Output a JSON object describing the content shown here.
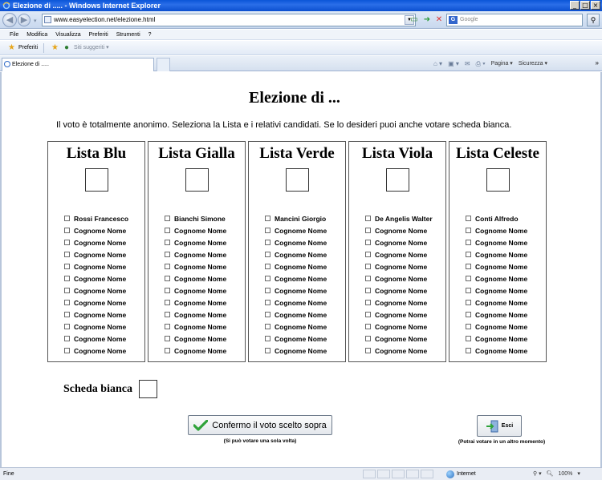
{
  "window": {
    "title": "Elezione di ..... - Windows Internet Explorer",
    "minimize": "_",
    "maximize": "□",
    "close": "×"
  },
  "address": {
    "url": "www.easyelection.net/elezione.html",
    "search_placeholder": "Google"
  },
  "menu": [
    "File",
    "Modifica",
    "Visualizza",
    "Preferiti",
    "Strumenti",
    "?"
  ],
  "favorites": {
    "label": "Preferiti",
    "suggested": "Siti suggeriti ▾"
  },
  "tab": {
    "label": "Elezione di .....",
    "commands": [
      "Pagina ▾",
      "Sicurezza ▾"
    ],
    "more": "»"
  },
  "page": {
    "title": "Elezione di ...",
    "intro": "Il voto è totalmente anonimo. Seleziona la Lista e i relativi candidati. Se lo desideri puoi anche votare scheda bianca.",
    "lists": [
      {
        "name": "Lista Blu",
        "candidates": [
          "Rossi Francesco",
          "Cognome Nome",
          "Cognome Nome",
          "Cognome Nome",
          "Cognome Nome",
          "Cognome Nome",
          "Cognome Nome",
          "Cognome Nome",
          "Cognome Nome",
          "Cognome Nome",
          "Cognome Nome",
          "Cognome Nome"
        ]
      },
      {
        "name": "Lista Gialla",
        "candidates": [
          "Bianchi Simone",
          "Cognome Nome",
          "Cognome Nome",
          "Cognome Nome",
          "Cognome Nome",
          "Cognome Nome",
          "Cognome Nome",
          "Cognome Nome",
          "Cognome Nome",
          "Cognome Nome",
          "Cognome Nome",
          "Cognome Nome"
        ]
      },
      {
        "name": "Lista Verde",
        "candidates": [
          "Mancini Giorgio",
          "Cognome Nome",
          "Cognome Nome",
          "Cognome Nome",
          "Cognome Nome",
          "Cognome Nome",
          "Cognome Nome",
          "Cognome Nome",
          "Cognome Nome",
          "Cognome Nome",
          "Cognome Nome",
          "Cognome Nome"
        ]
      },
      {
        "name": "Lista Viola",
        "candidates": [
          "De Angelis Walter",
          "Cognome Nome",
          "Cognome Nome",
          "Cognome Nome",
          "Cognome Nome",
          "Cognome Nome",
          "Cognome Nome",
          "Cognome Nome",
          "Cognome Nome",
          "Cognome Nome",
          "Cognome Nome",
          "Cognome Nome"
        ]
      },
      {
        "name": "Lista Celeste",
        "candidates": [
          "Conti Alfredo",
          "Cognome Nome",
          "Cognome Nome",
          "Cognome Nome",
          "Cognome Nome",
          "Cognome Nome",
          "Cognome Nome",
          "Cognome Nome",
          "Cognome Nome",
          "Cognome Nome",
          "Cognome Nome",
          "Cognome Nome"
        ]
      }
    ],
    "blank_ballot_label": "Scheda bianca",
    "confirm_label": "Confermo il voto scelto sopra",
    "confirm_note": "(Si può votare una sola volta)",
    "exit_label": "Esci",
    "exit_note": "(Potrai votare in un altro momento)"
  },
  "status": {
    "text": "Fine",
    "zone": "Internet",
    "zoom": "100%"
  },
  "colors": {
    "titlebar": "#0a55d8",
    "check": "#2fa33a"
  }
}
